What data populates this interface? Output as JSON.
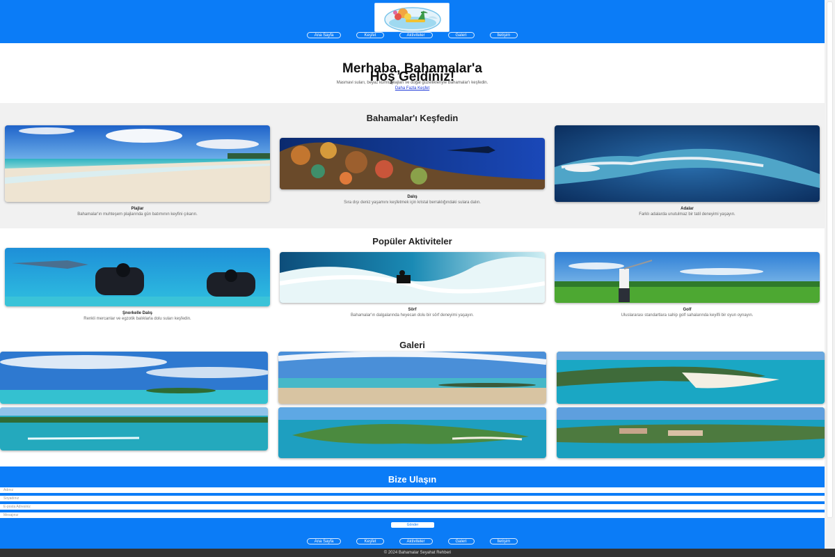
{
  "nav": [
    "Ana Sayfa",
    "Keşfet",
    "Aktiviteler",
    "Galeri",
    "İletişim"
  ],
  "hero": {
    "title_line1": "Merhaba, Bahamalar'a",
    "title_line2": "Hoş Geldiniz!",
    "subtitle": "Masmavi suları, beyaz kumlu plajları ve doğal güzellikleriyle Bahamalar'ı keşfedin.",
    "link": "Daha Fazla Keşfet"
  },
  "explore": {
    "title": "Bahamalar'ı Keşfedin",
    "cards": [
      {
        "title": "Plajlar",
        "text": "Bahamalar'ın muhteşem plajlarında gün batımının keyfini çıkarın.",
        "image": "beach-photo"
      },
      {
        "title": "Dalış",
        "text": "Sıra dışı deniz yaşamını keşfetmek için kristal berraklığındaki sulara dalın.",
        "image": "reef-photo"
      },
      {
        "title": "Adalar",
        "text": "Farklı adalarda unutulmaz bir tatil deneyimi yaşayın.",
        "image": "island-satellite-photo"
      }
    ]
  },
  "activities": {
    "title": "Popüler Aktiviteler",
    "cards": [
      {
        "title": "Şnorkelle Dalış",
        "text": "Renkli mercanlar ve egzotik balıklarla dolu suları keşfedin.",
        "image": "diving-photo"
      },
      {
        "title": "Sörf",
        "text": "Bahamalar'ın dalgalarında heyecan dolu bir sörf deneyimi yaşayın.",
        "image": "surf-photo"
      },
      {
        "title": "Golf",
        "text": "Uluslararası standartlara sahip golf sahalarında keyifli bir oyun oynayın.",
        "image": "golf-photo"
      }
    ]
  },
  "gallery": {
    "title": "Galeri"
  },
  "contact": {
    "title": "Bize Ulaşın",
    "fields": [
      "Adınız",
      "Soyadınız",
      "E-posta Adresiniz",
      "Mesajınız"
    ],
    "submit": "Gönder"
  },
  "footer": {
    "copyright": "© 2024 Bahamalar Seyahat Rehberi"
  },
  "colors": {
    "brand_blue": "#0b7cf7",
    "footer_dark": "#333333",
    "section_grey": "#f1f1f1"
  }
}
